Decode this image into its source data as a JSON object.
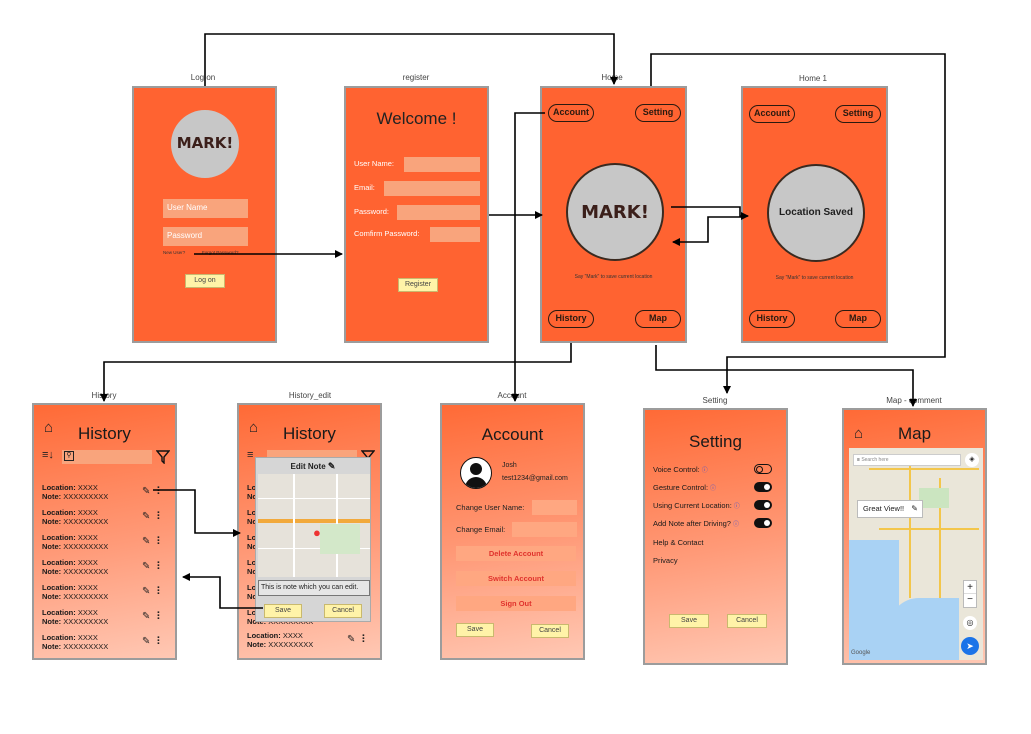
{
  "labels": {
    "logon": "Log on",
    "register": "register",
    "home": "Home",
    "home1": "Home 1",
    "history": "History",
    "history_edit": "History_edit",
    "account": "Account",
    "setting": "Setting",
    "map_comment": "Map - comment"
  },
  "logon": {
    "logo": "MARK!",
    "username_placeholder": "User Name",
    "password_placeholder": "Password",
    "new_user": "New User?",
    "forgot": "Forgot Password?",
    "button": "Log on"
  },
  "register": {
    "title": "Welcome !",
    "username": "User Name:",
    "email": "Email:",
    "password": "Password:",
    "confirm": "Comfirm Password:",
    "button": "Register"
  },
  "home": {
    "account": "Account",
    "setting": "Setting",
    "logo": "MARK!",
    "hint": "Say \"Mark\" to save current location",
    "history": "History",
    "map": "Map"
  },
  "home1": {
    "account": "Account",
    "setting": "Setting",
    "saved": "Location Saved",
    "hint": "Say \"Mark\" to save current location",
    "history": "History",
    "map": "Map"
  },
  "history": {
    "title": "History",
    "rows": [
      {
        "loc_label": "Location:",
        "loc": "XXXX",
        "note_label": "Note:",
        "note": "XXXXXXXXX"
      },
      {
        "loc_label": "Location:",
        "loc": "XXXX",
        "note_label": "Note:",
        "note": "XXXXXXXXX"
      },
      {
        "loc_label": "Location:",
        "loc": "XXXX",
        "note_label": "Note:",
        "note": "XXXXXXXXX"
      },
      {
        "loc_label": "Location:",
        "loc": "XXXX",
        "note_label": "Note:",
        "note": "XXXXXXXXX"
      },
      {
        "loc_label": "Location:",
        "loc": "XXXX",
        "note_label": "Note:",
        "note": "XXXXXXXXX"
      },
      {
        "loc_label": "Location:",
        "loc": "XXXX",
        "note_label": "Note:",
        "note": "XXXXXXXXX"
      },
      {
        "loc_label": "Location:",
        "loc": "XXXX",
        "note_label": "Note:",
        "note": "XXXXXXXXX"
      }
    ]
  },
  "history_edit": {
    "title": "History",
    "dialog_title": "Edit Note",
    "note_text": "This is note which you can edit.",
    "save": "Save",
    "cancel": "Cancel",
    "last_loc_label": "Location:",
    "last_loc": "XXXX",
    "last_note_label": "Note:",
    "last_note": "XXXXXXXXX"
  },
  "account": {
    "title": "Account",
    "name": "Josh",
    "email": "test1234@gmail.com",
    "change_user": "Change User Name:",
    "change_email": "Change Email:",
    "delete": "Delete Account",
    "switch": "Switch Account",
    "signout": "Sign Out",
    "save": "Save",
    "cancel": "Cancel"
  },
  "setting": {
    "title": "Setting",
    "rows": [
      "Voice Control:",
      "Gesture Control:",
      "Using Current Location:",
      "Add Note after Driving?"
    ],
    "help": "Help & Contact",
    "privacy": "Privacy",
    "save": "Save",
    "cancel": "Cancel"
  },
  "map": {
    "title": "Map",
    "search": "Search here",
    "bubble": "Great View!!",
    "zoom_in": "+",
    "zoom_out": "−",
    "brand": "Google"
  }
}
